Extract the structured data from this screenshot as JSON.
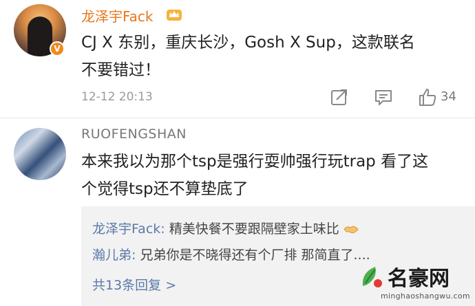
{
  "comments": [
    {
      "username": "龙泽宇Fack",
      "text_line1": "CJ X 东别，重庆长沙，Gosh X Sup，这款联名",
      "text_line2": "不要错过！",
      "time": "12-12 20:13",
      "likes": "34",
      "badge": "V",
      "icons": [
        "crown-icon",
        "verified-badge-icon",
        "share-icon",
        "reply-icon",
        "like-icon"
      ]
    },
    {
      "username": "RUOFENGSHAN",
      "text_line1": "本来我以为那个tsp是强行耍帅强行玩trap 看了这",
      "text_line2": "个觉得tsp还不算垫底了"
    }
  ],
  "replies": [
    {
      "name": "龙泽宇Fack:",
      "text": " 精美快餐不要跟隔壁家土味比"
    },
    {
      "name": "瀚儿弟:",
      "text": " 兄弟你是不晓得还有个厂排 那简直了...."
    }
  ],
  "more_replies": "共13条回复 >",
  "watermark": {
    "title": "名豪网",
    "url": "minghaoshangwu.com"
  },
  "colors": {
    "username_orange": "#e8761a",
    "link_blue": "#5b79a8",
    "reply_bg": "#f2f2f2"
  }
}
